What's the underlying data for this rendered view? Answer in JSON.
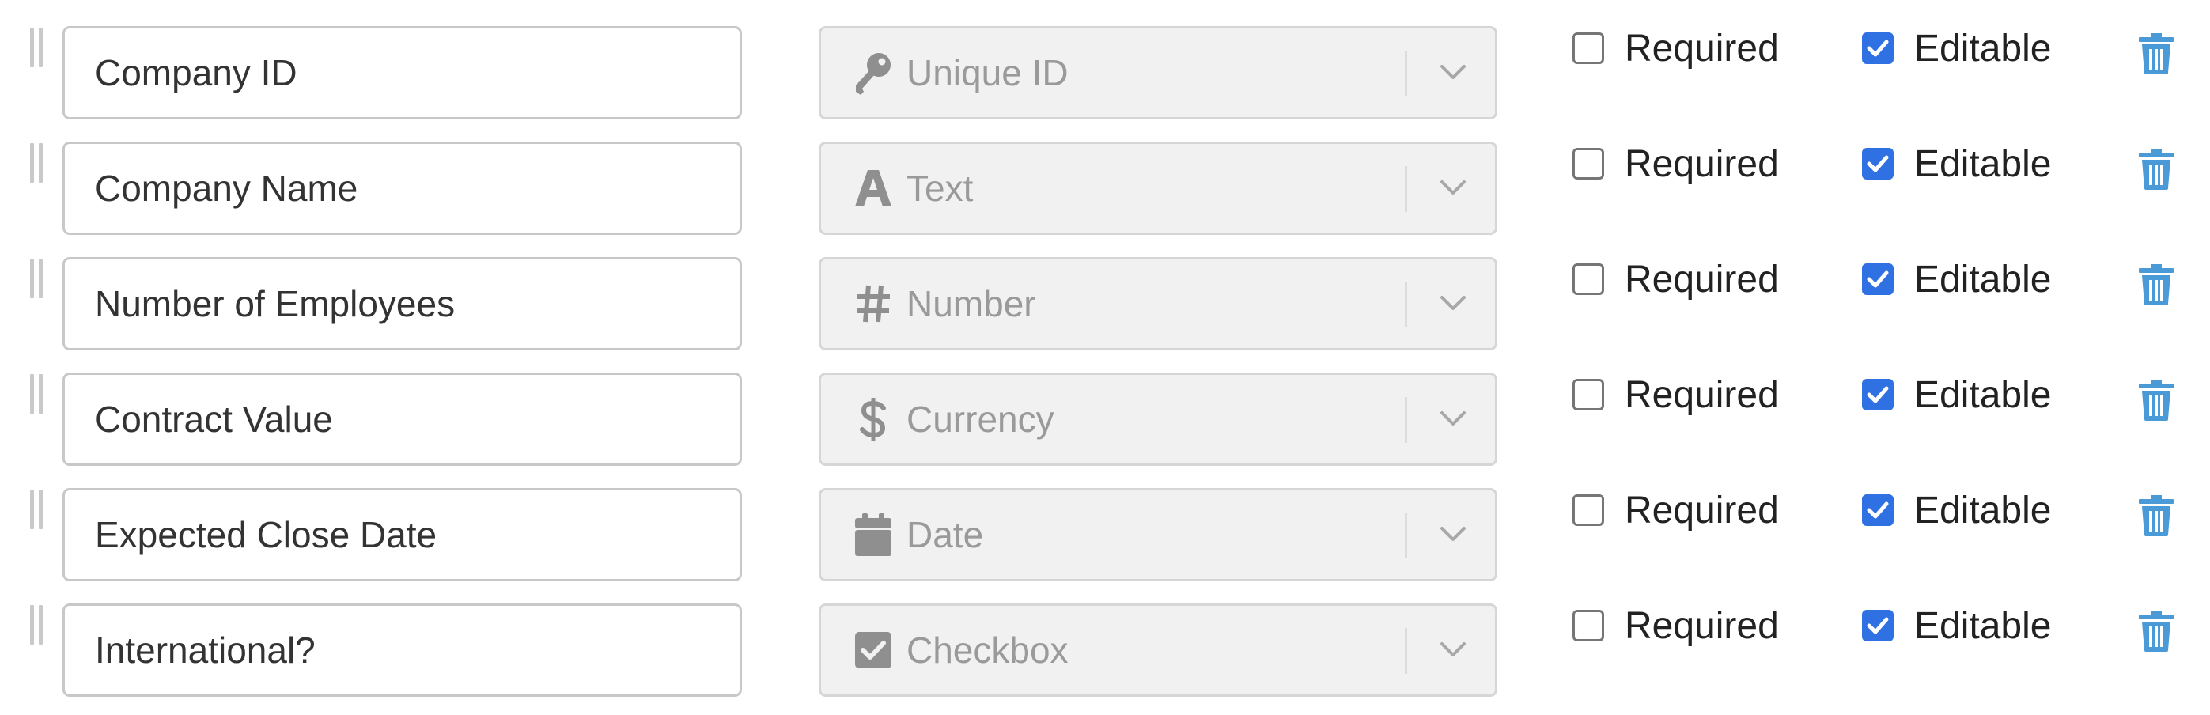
{
  "fields": [
    {
      "name": "Company ID",
      "type_label": "Unique ID",
      "type_icon": "key-icon",
      "required_label": "Required",
      "required_checked": false,
      "editable_label": "Editable",
      "editable_checked": true
    },
    {
      "name": "Company Name",
      "type_label": "Text",
      "type_icon": "text-icon",
      "required_label": "Required",
      "required_checked": false,
      "editable_label": "Editable",
      "editable_checked": true
    },
    {
      "name": "Number of Employees",
      "type_label": "Number",
      "type_icon": "hash-icon",
      "required_label": "Required",
      "required_checked": false,
      "editable_label": "Editable",
      "editable_checked": true
    },
    {
      "name": "Contract Value",
      "type_label": "Currency",
      "type_icon": "dollar-icon",
      "required_label": "Required",
      "required_checked": false,
      "editable_label": "Editable",
      "editable_checked": true
    },
    {
      "name": "Expected Close Date",
      "type_label": "Date",
      "type_icon": "calendar-icon",
      "required_label": "Required",
      "required_checked": false,
      "editable_label": "Editable",
      "editable_checked": true
    },
    {
      "name": "International?",
      "type_label": "Checkbox",
      "type_icon": "checkbox-icon",
      "required_label": "Required",
      "required_checked": false,
      "editable_label": "Editable",
      "editable_checked": true
    }
  ],
  "colors": {
    "checkbox_checked": "#2f71e3",
    "delete_icon": "#4b9ad8",
    "type_icon": "#8f8f8f"
  }
}
